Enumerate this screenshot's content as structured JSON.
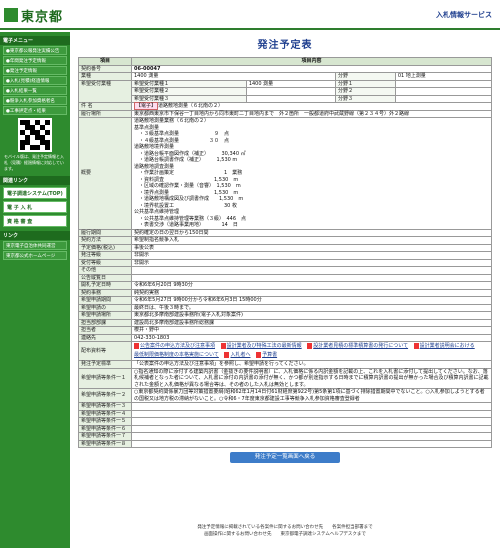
{
  "header": {
    "logo_text": "東京都",
    "service_link": "入札情報サービス"
  },
  "sidebar": {
    "menu_heading": "電子メニュー",
    "links": [
      "●東京都公報発注実績公告",
      "●年間発注予定情報",
      "●発注予定情報",
      "●入札(見積)経過情報",
      "●入札結果一覧",
      "●競争入札参加資格者名",
      "●工事評定点・結果"
    ],
    "mobile_note": "モバイル版は、発注予定情報と入札（見積）経過情報に対応しています。",
    "related_heading": "関連リンク",
    "related_buttons": [
      "電子調達システム(TOP)",
      "電 子 入 札",
      "資 格 審 査"
    ],
    "link_heading": "リンク",
    "external_links": [
      "東京電子自治体共同運営",
      "東京都公式ホームページ"
    ]
  },
  "main": {
    "title": "発注予定表",
    "col_item": "項目",
    "col_content": "項目内容",
    "rows": {
      "contract_no_label": "契約番号",
      "contract_no": "06-00047",
      "category_label": "業種",
      "category": "1400 測量",
      "content_label": "分野",
      "content_value": "01 地上測量",
      "desired_label": "希望受付業種",
      "desired1": "希望受付業種１",
      "desired1_value": "1400 測量",
      "desired2": "希望受付業種２",
      "desired3": "希望受付業種３",
      "field1": "分野１",
      "field2": "分野２",
      "field3": "分野３",
      "subject_label": "件 名",
      "subject_chip": "【電子】",
      "subject": "道路敷地測量（６北南の２）",
      "location_label": "履行場所",
      "location": "東京都西東京市下保谷一丁目地内から同市東町二丁目地内まで　外２箇所　一般都道府中武蔵野線（第２３４号）外２路線",
      "summary_label": "概要",
      "summary_lines": [
        "道路敷地測量業務（６北南の２）",
        "基準点測量",
        "　・３級基準点測量　　　　　　　９　点",
        "　・４級基準点測量　　　　　　３０　点",
        "道路敷地境界測量",
        "　・道路台帳平面図作成（補正）　　　30,340 ㎡",
        "　・道路台帳調書作成（補正）　　　1,530 m",
        "道路敷地調査測量",
        "　・作業計画策定　　　　　　　　　　1　業務",
        "　・資料調査　　　　　　　　　　1,530　m",
        "　・区域の確認作業・測量（音響）　1,530　m",
        "　・境界点測量　　　　　　　　　1,530　m",
        "　・道路敷地構成図及び調書作成　　1,530　m",
        "　・境界杭設置工　　　　　　　　　　30 枚",
        "公共基準点維持管理",
        "　・公共基準点維持管理等業務（３級）　446　点",
        "　・表書交渉（道路事業用地）　　　　14　日"
      ],
      "period_label": "履行期間",
      "period": "契約確定の日の翌日から150日間",
      "method_label": "契約方法",
      "method": "希望制指名競争入札",
      "price_label": "予定価格(税込)",
      "price": "事後公表",
      "ordered_label": "発注等級",
      "ordered": "非開示",
      "accept_label": "受付等級",
      "accept": "非開示",
      "other_label": "その他",
      "pubdate_label": "公告縦覧日",
      "opendate_label": "開札予定日時",
      "opendate": "令和6年6月20日 9時30分",
      "time_label": "契約事務",
      "time": "純契約実務",
      "apply_label": "希望申請期間",
      "apply": "令和6年5月27日 9時00分から令和6年6月3日 15時00分",
      "notice_label": "希望申請の",
      "notice": "最終日は、午後３時まで。",
      "agency_label": "希望申請場所",
      "agency": "東京都北多摩南部建設事務所(電子入札対象案件)",
      "dept_label": "担当部部課",
      "dept": "建設局北多摩南部建設事務所総務課",
      "contact_label": "担当者",
      "contact": "櫻井・野中",
      "tel_label": "連絡先",
      "tel": "042-330-1803",
      "docs_label": "配布資料等",
      "docs": [
        "公告案件の申込方法及び注意事項",
        "設計業者及び特殊工法の最新情報",
        "設計業者見積の標準積算書の発行について",
        "設計業者説明会における",
        "最低制限価格制度の本格実施について",
        "入札者へ",
        "予算書"
      ],
      "order_label": "発注予定標準",
      "order": "「公表案件の申込方法及び注意事項」を参照し、希望申請を行ってください。",
      "cond1_label": "希望申請等条件一１",
      "cond1": "○指名通知の際に添付する建築内訳書（金抜きの要件説明書）に、入札価格に係る内訳金額を記載の上、これを入札書に添付して提出してください。なお、落札候補者となった者について、入札書に添付の内訳書の添付が無く、かつ都が別途指示する日時までに積算内訳書の提出が無かった場合及び積算内訳書に記載された金額と入札価格が異なる場合等は、その者のした入札は無効とします。",
      "cond2_label": "希望申請等条件一２",
      "cond2": "○東京都契約関係暴力団等対策措置要綱(昭和62年1月14日付61財経庶第922号)第5条第1項に基づく排除措置期間中でないこと。○入札参加しようとする者の国税又は地方税の滞納がないこと。○令和6・7年度東京都建設工事等競争入札参加資格審査登録者",
      "cond3_label": "希望申請等条件一３",
      "cond4_label": "希望申請等条件一４",
      "cond5_label": "希望申請等条件一５",
      "cond6_label": "希望申請等条件一６",
      "cond7_label": "希望申請等条件一７",
      "cond8_label": "希望申請等条件一８",
      "back_button": "発注予定一覧画面へ戻る"
    }
  },
  "footer": {
    "line1": "発注予定情報に掲載されている各案件に関するお問い合わせ先　　各案件担当部署まで",
    "line2": "画面操作に関するお問い合わせ先　　東京都電子調達システムヘルプデスクまで"
  }
}
